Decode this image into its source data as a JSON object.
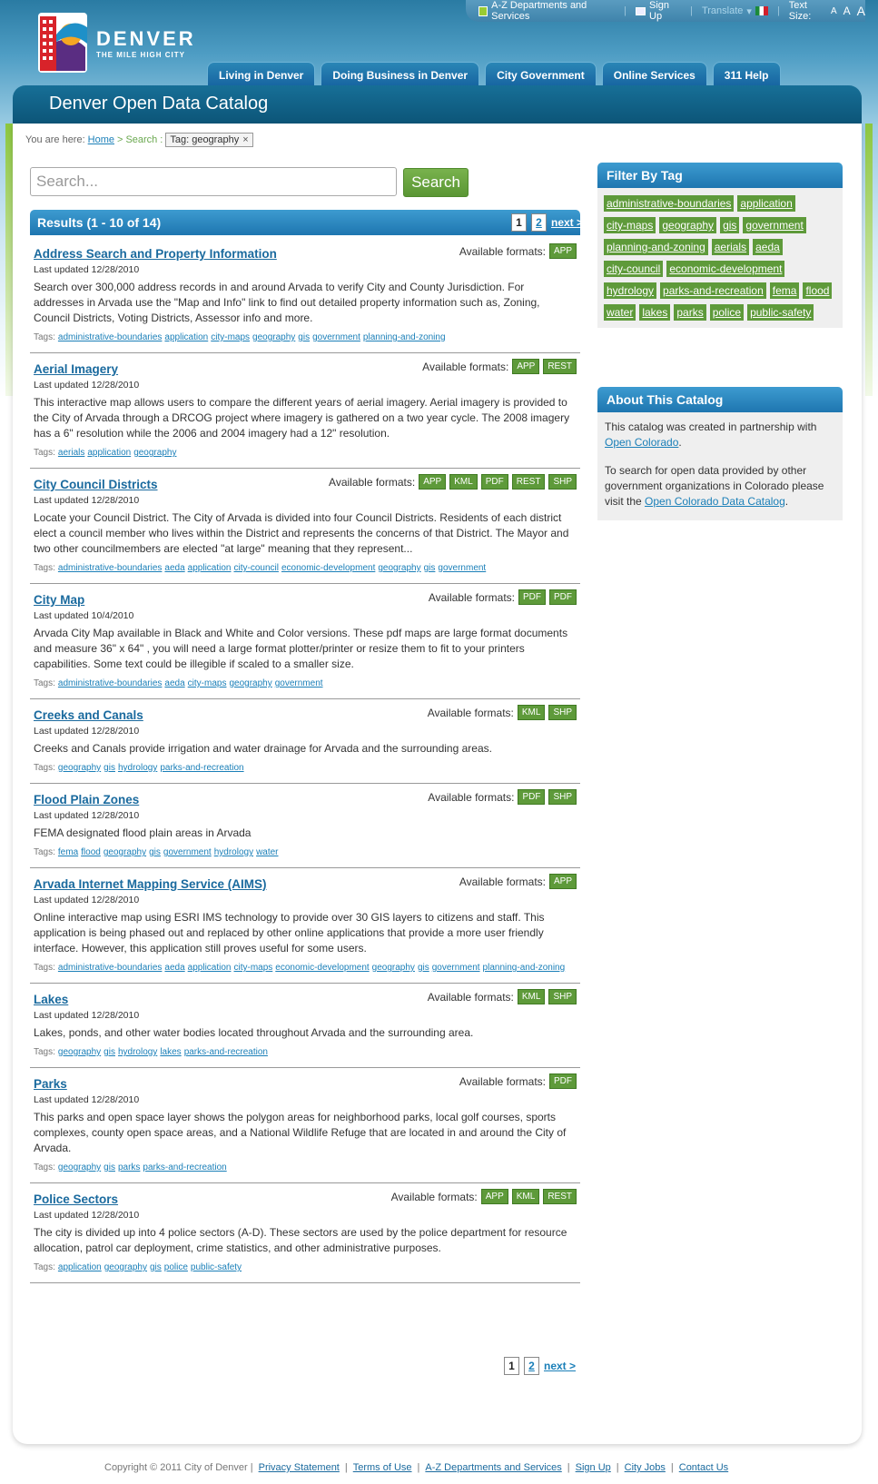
{
  "topbar": {
    "az_label": "A-Z Departments and Services",
    "signup_label": "Sign Up",
    "translate_label": "Translate",
    "text_size_label": "Text Size:",
    "size_a1": "A",
    "size_a2": "A",
    "size_a3": "A"
  },
  "logo": {
    "name": "DENVER",
    "tagline": "THE MILE HIGH CITY"
  },
  "nav": [
    "Living in Denver",
    "Doing Business in Denver",
    "City Government",
    "Online Services",
    "311 Help"
  ],
  "page_title": "Denver Open Data Catalog",
  "breadcrumb": {
    "prefix": "You are here:",
    "home": "Home",
    "sep1": ">",
    "search": "Search",
    "sep2": ":",
    "tag": "Tag: geography",
    "remove": "×"
  },
  "search": {
    "placeholder": "Search...",
    "button": "Search"
  },
  "results": {
    "header": "Results (1 - 10 of 14)",
    "page1": "1",
    "page2": "2",
    "next": "next >",
    "formats_label": "Available formats:",
    "tags_label": "Tags:",
    "items": [
      {
        "title": "Address Search and Property Information",
        "formats": [
          "APP"
        ],
        "updated": "Last updated 12/28/2010",
        "desc": "Search over 300,000 address records in and around Arvada to verify City and County Jurisdiction. For addresses in Arvada use the \"Map and Info\" link to find out detailed property information such as, Zoning, Council Districts, Voting Districts, Assessor info and more.",
        "tags": [
          "administrative-boundaries",
          "application",
          "city-maps",
          "geography",
          "gis",
          "government",
          "planning-and-zoning"
        ]
      },
      {
        "title": "Aerial Imagery",
        "formats": [
          "APP",
          "REST"
        ],
        "updated": "Last updated 12/28/2010",
        "desc": "This interactive map allows users to compare the different years of aerial imagery. Aerial imagery is provided to the City of Arvada through a DRCOG project where imagery is gathered on a two year cycle. The 2008 imagery has a 6\" resolution while the 2006 and 2004 imagery had a 12\" resolution.",
        "tags": [
          "aerials",
          "application",
          "geography"
        ]
      },
      {
        "title": "City Council Districts",
        "formats": [
          "APP",
          "KML",
          "PDF",
          "REST",
          "SHP"
        ],
        "updated": "Last updated 12/28/2010",
        "desc": "Locate your Council District. The City of Arvada is divided into four Council Districts. Residents of each district elect a council member who lives within the District and represents the concerns of that District. The Mayor and two other councilmembers are elected \"at large\" meaning that they represent...",
        "tags": [
          "administrative-boundaries",
          "aeda",
          "application",
          "city-council",
          "economic-development",
          "geography",
          "gis",
          "government"
        ]
      },
      {
        "title": "City Map",
        "formats": [
          "PDF",
          "PDF"
        ],
        "updated": "Last updated 10/4/2010",
        "desc": "Arvada City Map available in Black and White and Color versions. These pdf maps are large format documents and measure 36\" x 64\" , you will need a large format plotter/printer or resize them to fit to your printers capabilities. Some text could be illegible if scaled to a smaller size.",
        "tags": [
          "administrative-boundaries",
          "aeda",
          "city-maps",
          "geography",
          "government"
        ]
      },
      {
        "title": "Creeks and Canals",
        "formats": [
          "KML",
          "SHP"
        ],
        "updated": "Last updated 12/28/2010",
        "desc": "Creeks and Canals provide irrigation and water drainage for Arvada and the surrounding areas.",
        "tags": [
          "geography",
          "gis",
          "hydrology",
          "parks-and-recreation"
        ]
      },
      {
        "title": "Flood Plain Zones",
        "formats": [
          "PDF",
          "SHP"
        ],
        "updated": "Last updated 12/28/2010",
        "desc": "FEMA designated flood plain areas in Arvada",
        "tags": [
          "fema",
          "flood",
          "geography",
          "gis",
          "government",
          "hydrology",
          "water"
        ]
      },
      {
        "title": "Arvada Internet Mapping Service (AIMS)",
        "formats": [
          "APP"
        ],
        "updated": "Last updated 12/28/2010",
        "desc": "Online interactive map using ESRI IMS technology to provide over 30 GIS layers to citizens and staff. This application is being phased out and replaced by other online applications that provide a more user friendly interface. However, this application still proves useful for some users.",
        "tags": [
          "administrative-boundaries",
          "aeda",
          "application",
          "city-maps",
          "economic-development",
          "geography",
          "gis",
          "government",
          "planning-and-zoning"
        ]
      },
      {
        "title": "Lakes",
        "formats": [
          "KML",
          "SHP"
        ],
        "updated": "Last updated 12/28/2010",
        "desc": "Lakes, ponds, and other water bodies located throughout Arvada and the surrounding area.",
        "tags": [
          "geography",
          "gis",
          "hydrology",
          "lakes",
          "parks-and-recreation"
        ]
      },
      {
        "title": "Parks",
        "formats": [
          "PDF"
        ],
        "updated": "Last updated 12/28/2010",
        "desc": "This parks and open space layer shows the polygon areas for neighborhood parks, local golf courses, sports complexes, county open space areas, and a National Wildlife Refuge that are located in and around the City of Arvada.",
        "tags": [
          "geography",
          "gis",
          "parks",
          "parks-and-recreation"
        ]
      },
      {
        "title": "Police Sectors",
        "formats": [
          "APP",
          "KML",
          "REST"
        ],
        "updated": "Last updated 12/28/2010",
        "desc": "The city is divided up into 4 police sectors (A-D). These sectors are used by the police department for resource allocation, patrol car deployment, crime statistics, and other administrative purposes.",
        "tags": [
          "application",
          "geography",
          "gis",
          "police",
          "public-safety"
        ]
      }
    ]
  },
  "filter": {
    "title": "Filter By Tag",
    "tags": [
      "administrative-boundaries",
      "application",
      "city-maps",
      "geography",
      "gis",
      "government",
      "planning-and-zoning",
      "aerials",
      "aeda",
      "city-council",
      "economic-development",
      "hydrology",
      "parks-and-recreation",
      "fema",
      "flood",
      "water",
      "lakes",
      "parks",
      "police",
      "public-safety"
    ]
  },
  "about": {
    "title": "About This Catalog",
    "p1_text": "This catalog was created in partnership with ",
    "p1_link": "Open Colorado",
    "p1_end": ".",
    "p2_text": "To search for open data provided by other government organizations in Colorado please visit the ",
    "p2_link": "Open Colorado Data Catalog",
    "p2_end": "."
  },
  "footer": {
    "copyright": "Copyright © 2011 City of Denver |",
    "links": [
      "Privacy Statement",
      "Terms of Use",
      "A-Z Departments and Services",
      "Sign Up",
      "City Jobs",
      "Contact Us"
    ]
  },
  "colors": {
    "brand_blue": "#1e76b0",
    "tag_green": "#5e9a3a",
    "link": "#1a7fb8"
  }
}
